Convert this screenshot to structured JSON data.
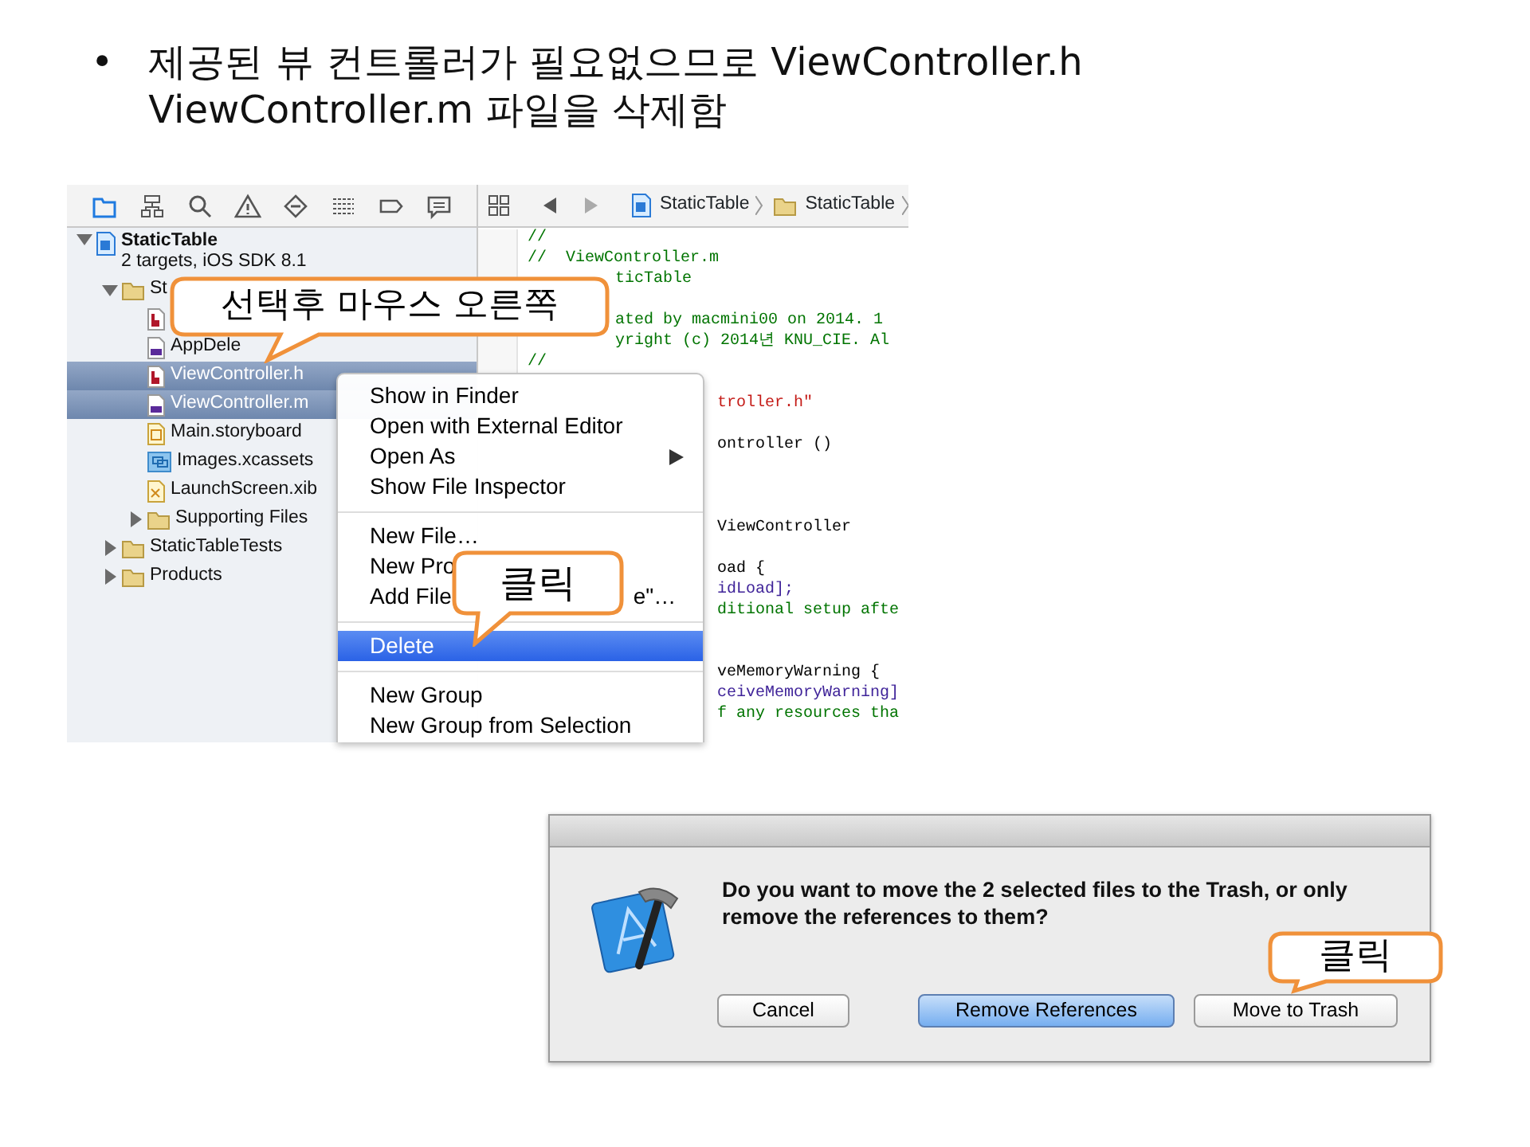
{
  "slide_text": "제공된 뷰 컨트롤러가 필요없으므로 ViewController.h ViewController.m 파일을 삭제함",
  "bullet": "•",
  "navigator_tabs": [
    {
      "selected": true
    },
    {
      "selected": false
    },
    {
      "selected": false
    },
    {
      "selected": false
    },
    {
      "selected": false
    },
    {
      "selected": false
    },
    {
      "selected": false
    },
    {
      "selected": false
    }
  ],
  "jump_bar": [
    {
      "kind": "project",
      "label": "StaticTable"
    },
    {
      "kind": "folder",
      "label": "StaticTable"
    }
  ],
  "tree": [
    {
      "kind": "project",
      "name": "StaticTable",
      "subtitle": "2 targets, iOS SDK 8.1",
      "expanded": true,
      "selected": false,
      "children": [
        {
          "kind": "folder",
          "name": "St",
          "expanded": true,
          "selected": false,
          "children": [
            {
              "kind": "header",
              "selected": false
            },
            {
              "kind": "source",
              "name": "AppDele",
              "selected": false
            },
            {
              "kind": "header",
              "name": "ViewController.h",
              "selected": true
            },
            {
              "kind": "source",
              "name": "ViewController.m",
              "selected": true
            },
            {
              "kind": "storyboard",
              "name": "Main.storyboard",
              "selected": false
            },
            {
              "kind": "assets",
              "name": "Images.xcassets",
              "selected": false
            },
            {
              "kind": "xib",
              "name": "LaunchScreen.xib",
              "selected": false
            },
            {
              "kind": "folder",
              "name": "Supporting Files",
              "expanded": false,
              "selected": false
            }
          ]
        },
        {
          "kind": "folder",
          "name": "StaticTableTests",
          "expanded": false,
          "selected": false
        },
        {
          "kind": "folder",
          "name": "Products",
          "expanded": false,
          "selected": false
        }
      ]
    }
  ],
  "code_lines": [
    {
      "kind": "comment",
      "text": "//"
    },
    {
      "kind": "comment",
      "text": "//  ViewController.m"
    },
    {
      "kind": "comment",
      "text": "ticTable"
    },
    {
      "kind": "blank"
    },
    {
      "kind": "comment",
      "text": "ated by macmini00 on 2014. 1"
    },
    {
      "kind": "comment",
      "text": "yright (c) 2014년 KNU_CIE. Al"
    },
    {
      "kind": "comment",
      "text": "//"
    },
    {
      "kind": "blank"
    },
    {
      "kind": "string",
      "text": "troller.h\""
    },
    {
      "kind": "blank"
    },
    {
      "kind": "code",
      "text": "ontroller ()"
    },
    {
      "kind": "blank"
    },
    {
      "kind": "blank"
    },
    {
      "kind": "blank"
    },
    {
      "kind": "code",
      "text": "ViewController"
    },
    {
      "kind": "blank"
    },
    {
      "kind": "code",
      "text": "oad {"
    },
    {
      "kind": "method",
      "text": "idLoad];"
    },
    {
      "kind": "comment",
      "text": "ditional setup afte"
    },
    {
      "kind": "blank"
    },
    {
      "kind": "blank"
    },
    {
      "kind": "code",
      "text": "veMemoryWarning {"
    },
    {
      "kind": "method",
      "text": "ceiveMemoryWarning]"
    },
    {
      "kind": "comment",
      "text": "f any resources tha"
    }
  ],
  "context_menu": [
    {
      "kind": "item",
      "label": "Show in Finder",
      "selected": false
    },
    {
      "kind": "item",
      "label": "Open with External Editor",
      "selected": false
    },
    {
      "kind": "item",
      "label": "Open As",
      "selected": false,
      "submenu": true
    },
    {
      "kind": "item",
      "label": "Show File Inspector",
      "selected": false
    },
    {
      "kind": "separator"
    },
    {
      "kind": "item",
      "label": "New File…",
      "selected": false
    },
    {
      "kind": "item",
      "label": "New Pro",
      "selected": false
    },
    {
      "kind": "item",
      "label": "Add File",
      "trailing": "e\"…",
      "selected": false
    },
    {
      "kind": "separator"
    },
    {
      "kind": "item",
      "label": "Delete",
      "selected": true
    },
    {
      "kind": "separator"
    },
    {
      "kind": "item",
      "label": "New Group",
      "selected": false
    },
    {
      "kind": "item",
      "label": "New Group from Selection",
      "selected": false
    }
  ],
  "callouts": [
    {
      "text": "선택후 마우스 오른쪽"
    },
    {
      "text": "클릭"
    },
    {
      "text": "클릭"
    }
  ],
  "dialog": {
    "message": "Do you want to move the 2 selected files to the Trash, or only remove the references to them?",
    "buttons": [
      {
        "label": "Cancel",
        "default": false
      },
      {
        "label": "Remove References",
        "default": true
      },
      {
        "label": "Move to Trash",
        "default": false
      }
    ]
  }
}
